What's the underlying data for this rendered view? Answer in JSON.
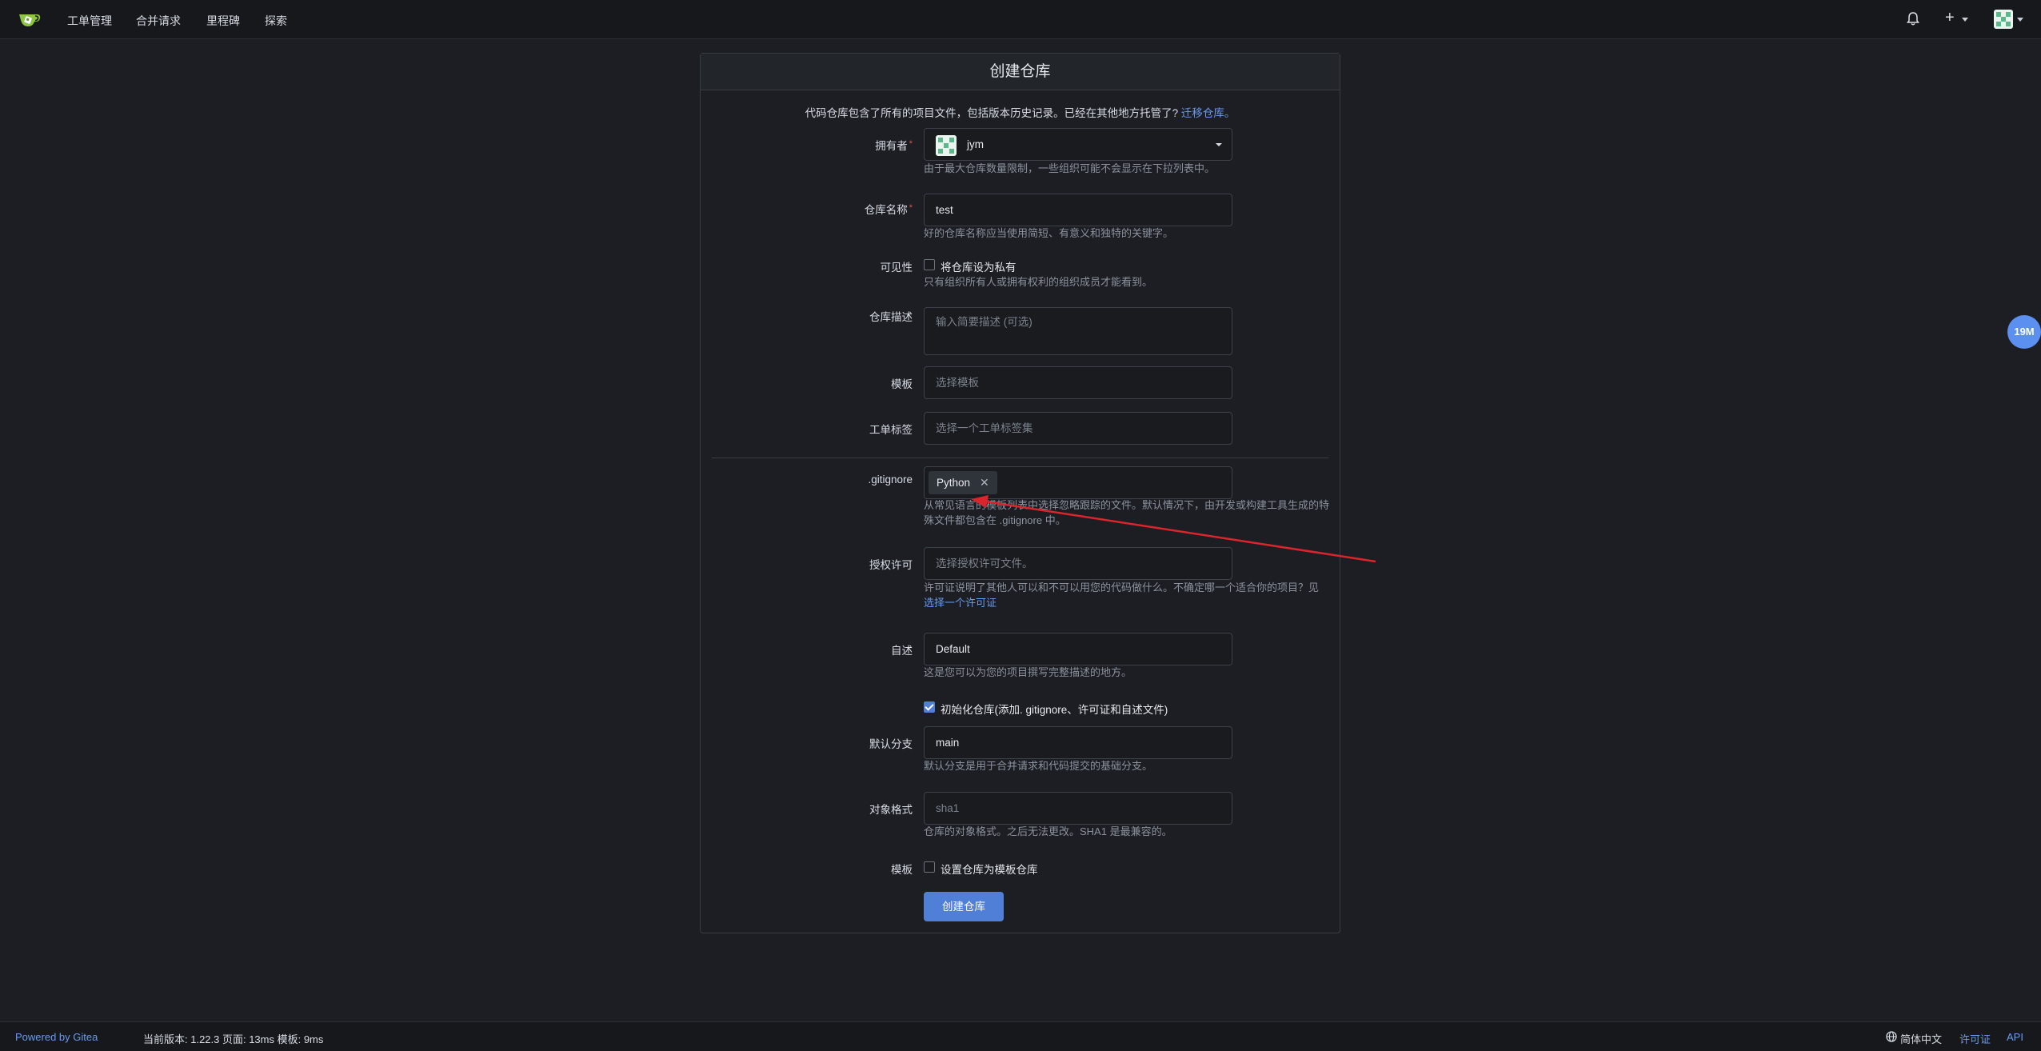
{
  "nav": {
    "items": [
      "工单管理",
      "合并请求",
      "里程碑",
      "探索"
    ],
    "plus": "+"
  },
  "form": {
    "title": "创建仓库",
    "intro": "代码仓库包含了所有的项目文件，包括版本历史记录。已经在其他地方托管了?",
    "migrate_link": "迁移仓库。",
    "owner": {
      "label": "拥有者",
      "value": "jym",
      "help": "由于最大仓库数量限制，一些组织可能不会显示在下拉列表中。"
    },
    "repo_name": {
      "label": "仓库名称",
      "value": "test",
      "help": "好的仓库名称应当使用简短、有意义和独特的关键字。"
    },
    "visibility": {
      "label": "可见性",
      "checkbox_label": "将仓库设为私有",
      "help": "只有组织所有人或拥有权利的组织成员才能看到。"
    },
    "description": {
      "label": "仓库描述",
      "placeholder": "输入简要描述 (可选)"
    },
    "template": {
      "label": "模板",
      "placeholder": "选择模板"
    },
    "issue_labels": {
      "label": "工单标签",
      "placeholder": "选择一个工单标签集"
    },
    "gitignore": {
      "label": ".gitignore",
      "tag": "Python",
      "help": "从常见语言的模板列表中选择忽略跟踪的文件。默认情况下，由开发或构建工具生成的特殊文件都包含在 .gitignore 中。"
    },
    "license": {
      "label": "授权许可",
      "placeholder": "选择授权许可文件。",
      "help": "许可证说明了其他人可以和不可以用您的代码做什么。不确定哪一个适合你的项目？见",
      "help_link": "选择一个许可证"
    },
    "readme": {
      "label": "自述",
      "value": "Default",
      "help": "这是您可以为您的项目撰写完整描述的地方。"
    },
    "auto_init": {
      "label": "初始化仓库(添加. gitignore、许可证和自述文件)",
      "checked": true
    },
    "default_branch": {
      "label": "默认分支",
      "value": "main",
      "help": "默认分支是用于合并请求和代码提交的基础分支。"
    },
    "object_format": {
      "label": "对象格式",
      "placeholder": "sha1",
      "help": "仓库的对象格式。之后无法更改。SHA1 是最兼容的。"
    },
    "template_repo": {
      "label": "模板",
      "checkbox_label": "设置仓库为模板仓库"
    },
    "submit": "创建仓库"
  },
  "float_badge": "19M",
  "footer": {
    "powered": "Powered by Gitea",
    "version": "当前版本: 1.22.3 页面: 13ms 模板: 9ms",
    "language": "简体中文",
    "license": "许可证",
    "api": "API"
  },
  "colors": {
    "accent": "#4f7fd6",
    "link": "#6a9bee",
    "background": "#1c1e23",
    "annotation_arrow": "#d9252b"
  }
}
